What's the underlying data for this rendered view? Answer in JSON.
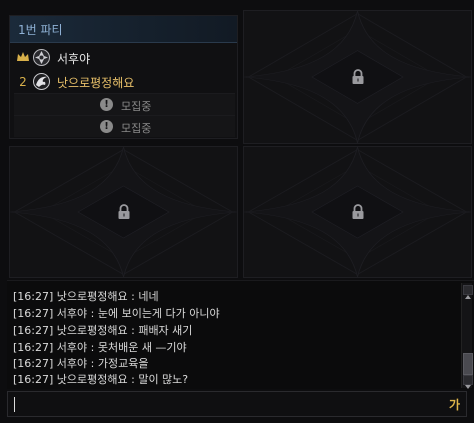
{
  "party": {
    "title": "1번 파티",
    "members": [
      {
        "rank_icon": "crown-icon",
        "avatar_icon": "guild-emblem-icon",
        "name": "서후야",
        "name_color": "#e6e6e6"
      },
      {
        "rank": "2",
        "avatar_icon": "dragon-emblem-icon",
        "name": "낫으로평정해요",
        "name_color": "#e8c069"
      }
    ],
    "recruit_slots": [
      {
        "icon": "warning-icon",
        "label": "모집중"
      },
      {
        "icon": "warning-icon",
        "label": "모집중"
      }
    ]
  },
  "locked_slots": [
    {
      "icon": "lock-icon"
    },
    {
      "icon": "lock-icon"
    },
    {
      "icon": "lock-icon"
    }
  ],
  "chat": {
    "lines": [
      "[16:27] 낫으로평정해요 : 네네",
      "[16:27] 서후야 : 눈에 보이는게 다가 아니야",
      "[16:27] 낫으로평정해요 : 패배자 새기",
      "[16:27] 서후야 : 못처배운 새 —기야",
      "[16:27] 서후야 : 가정교육을",
      "[16:27] 낫으로평정해요 : 말이 많노?"
    ]
  },
  "input": {
    "value": "",
    "ime_mode": "가"
  },
  "colors": {
    "accent_blue": "#8fb2d6",
    "leader_gold": "#d8b04a",
    "member_highlight": "#e8c069"
  }
}
